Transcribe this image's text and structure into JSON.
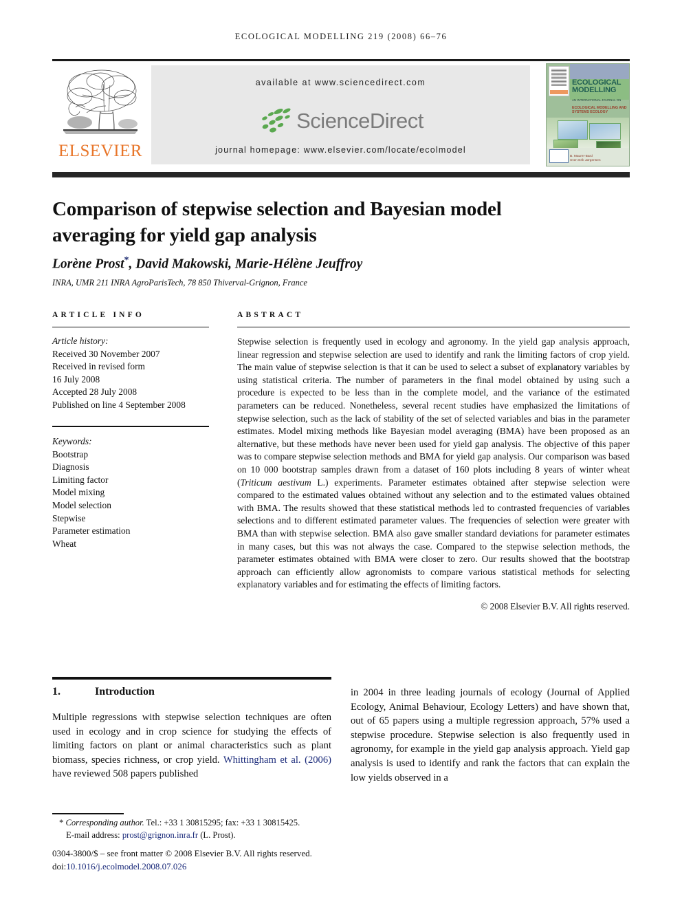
{
  "running_head": "ECOLOGICAL MODELLING 219 (2008) 66–76",
  "masthead": {
    "publisher_logo_text": "ELSEVIER",
    "publisher_logo_icon": "elsevier-tree-icon",
    "available_at": "available at www.sciencedirect.com",
    "sciencedirect_wordmark": "ScienceDirect",
    "sciencedirect_icon": "sciencedirect-dots-icon",
    "journal_homepage": "journal homepage: www.elsevier.com/locate/ecolmodel",
    "cover": {
      "title_line1": "ECOLOGICAL",
      "title_line2": "MODELLING",
      "subtitle": "AN INTERNATIONAL JOURNAL ON",
      "subtitle2_line1": "ECOLOGICAL MODELLING AND",
      "subtitle2_line2": "SYSTEMS ECOLOGY",
      "editors_line1": "B. Maurer-Bard",
      "editors_line2": "Sven Erik Jørgensen"
    }
  },
  "article": {
    "title": "Comparison of stepwise selection and Bayesian model averaging for yield gap analysis",
    "authors": "Lorène Prost",
    "corresponding_mark": "*",
    "authors_rest": ", David Makowski, Marie-Hélène Jeuffroy",
    "affiliation": "INRA, UMR 211 INRA AgroParisTech, 78 850 Thiverval-Grignon, France"
  },
  "article_info": {
    "heading": "ARTICLE INFO",
    "history_label": "Article history:",
    "received": "Received 30 November 2007",
    "revised_label": "Received in revised form",
    "revised_date": "16 July 2008",
    "accepted": "Accepted 28 July 2008",
    "published": "Published on line 4 September 2008",
    "keywords_label": "Keywords:",
    "keywords": [
      "Bootstrap",
      "Diagnosis",
      "Limiting factor",
      "Model mixing",
      "Model selection",
      "Stepwise",
      "Parameter estimation",
      "Wheat"
    ]
  },
  "abstract": {
    "heading": "ABSTRACT",
    "part1": "Stepwise selection is frequently used in ecology and agronomy. In the yield gap analysis approach, linear regression and stepwise selection are used to identify and rank the limiting factors of crop yield. The main value of stepwise selection is that it can be used to select a subset of explanatory variables by using statistical criteria. The number of parameters in the final model obtained by using such a procedure is expected to be less than in the complete model, and the variance of the estimated parameters can be reduced. Nonetheless, several recent studies have emphasized the limitations of stepwise selection, such as the lack of stability of the set of selected variables and bias in the parameter estimates. Model mixing methods like Bayesian model averaging (BMA) have been proposed as an alternative, but these methods have never been used for yield gap analysis. The objective of this paper was to compare stepwise selection methods and BMA for yield gap analysis. Our comparison was based on 10 000 bootstrap samples drawn from a dataset of 160 plots including 8 years of winter wheat (",
    "species": "Triticum aestivum",
    "part2": " L.) experiments. Parameter estimates obtained after stepwise selection were compared to the estimated values obtained without any selection and to the estimated values obtained with BMA. The results showed that these statistical methods led to contrasted frequencies of variables selections and to different estimated parameter values. The frequencies of selection were greater with BMA than with stepwise selection. BMA also gave smaller standard deviations for parameter estimates in many cases, but this was not always the case. Compared to the stepwise selection methods, the parameter estimates obtained with BMA were closer to zero. Our results showed that the bootstrap approach can efficiently allow agronomists to compare various statistical methods for selecting explanatory variables and for estimating the effects of limiting factors.",
    "copyright": "© 2008 Elsevier B.V. All rights reserved."
  },
  "introduction": {
    "number": "1.",
    "heading": "Introduction",
    "left_part1": "Multiple regressions with stepwise selection techniques are often used in ecology and in crop science for studying the effects of limiting factors on plant or animal characteristics such as plant biomass, species richness, or crop yield. ",
    "citation": "Whittingham et al. (2006)",
    "left_part2": " have reviewed 508 papers published",
    "right": "in 2004 in three leading journals of ecology (Journal of Applied Ecology, Animal Behaviour, Ecology Letters) and have shown that, out of 65 papers using a multiple regression approach, 57% used a stepwise procedure. Stepwise selection is also frequently used in agronomy, for example in the yield gap analysis approach. Yield gap analysis is used to identify and rank the factors that can explain the low yields observed in a"
  },
  "footer": {
    "corresponding_mark": "*",
    "corresponding_label": "Corresponding author.",
    "corresponding_contact": " Tel.: +33 1 30815295; fax: +33 1 30815425.",
    "email_label": "E-mail address:",
    "email": "prost@grignon.inra.fr",
    "email_owner": " (L. Prost).",
    "issn_line": "0304-3800/$ – see front matter © 2008 Elsevier B.V. All rights reserved.",
    "doi_label": "doi:",
    "doi": "10.1016/j.ecolmodel.2008.07.026"
  },
  "colors": {
    "elsevier_orange": "#e8762a",
    "sciencedirect_green": "#5aa84f",
    "sciencedirect_gray": "#7b7b7b",
    "band_gray": "#e8e8e8",
    "link_blue": "#1a2a7a"
  }
}
